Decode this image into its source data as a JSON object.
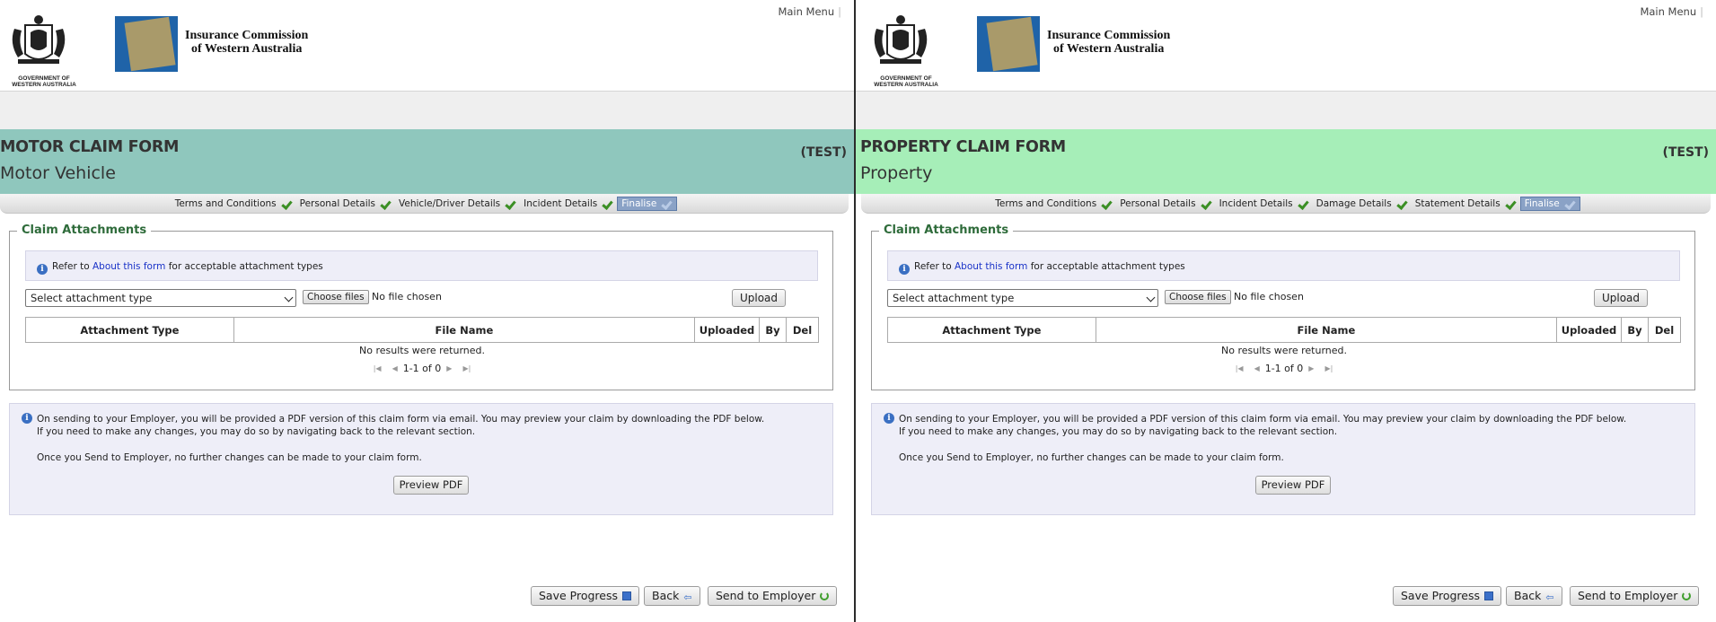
{
  "header": {
    "gov_logo_text": "GOVERNMENT OF WESTERN AUSTRALIA",
    "org_name_line1": "Insurance Commission",
    "org_name_line2": "of Western Australia",
    "main_menu": "Main Menu"
  },
  "colors": {
    "motor_band": "#8fc7bd",
    "property_band": "#a6eeb8",
    "legend_green": "#2e6b3a",
    "link_blue": "#1a33c8"
  },
  "panes": [
    {
      "title": "MOTOR CLAIM FORM",
      "subtitle": "Motor Vehicle",
      "test_tag": "(TEST)",
      "steps": [
        "Terms and Conditions",
        "Personal Details",
        "Vehicle/Driver Details",
        "Incident Details",
        "Finalise"
      ]
    },
    {
      "title": "PROPERTY CLAIM FORM",
      "subtitle": "Property",
      "test_tag": "(TEST)",
      "steps": [
        "Terms and Conditions",
        "Personal Details",
        "Incident Details",
        "Damage Details",
        "Statement Details",
        "Finalise"
      ]
    }
  ],
  "attachments": {
    "legend": "Claim Attachments",
    "info_prefix": "Refer to",
    "info_link": "About this form",
    "info_suffix": "for acceptable attachment types",
    "select_placeholder": "Select attachment type",
    "choose_files": "Choose files",
    "no_file": "No file chosen",
    "upload": "Upload",
    "columns": [
      "Attachment Type",
      "File Name",
      "Uploaded",
      "By",
      "Del"
    ],
    "no_results": "No results were returned.",
    "pager_text": "1-1 of 0"
  },
  "sending_info": {
    "line1": "On sending to your Employer, you will be provided a PDF version of this claim form via email. You may preview your claim by downloading the PDF below.",
    "line2": "If you need to make any changes, you may do so by navigating back to the relevant section.",
    "line3": "Once you Send to Employer, no further changes can be made to your claim form.",
    "preview_pdf": "Preview PDF"
  },
  "buttons": {
    "save_progress": "Save Progress",
    "back": "Back",
    "send": "Send to Employer"
  }
}
